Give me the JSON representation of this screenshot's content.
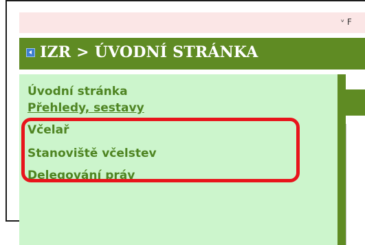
{
  "top_strip": {
    "partial_text": "ᵛ F"
  },
  "header": {
    "title": "IZR > ÚVODNÍ STRÁNKA"
  },
  "sidebar": {
    "items": [
      {
        "label": "Úvodní stránka"
      },
      {
        "label": "Přehledy, sestavy"
      },
      {
        "label": "Včelař"
      },
      {
        "label": "Stanoviště včelstev"
      },
      {
        "label": "Delegování práv"
      }
    ]
  },
  "colors": {
    "header_green": "#5f8b23",
    "sidebar_bg": "#ccf5cc",
    "link_green": "#4f8523",
    "highlight_red": "#e8141b",
    "top_strip_pink": "#fbe6e6"
  }
}
